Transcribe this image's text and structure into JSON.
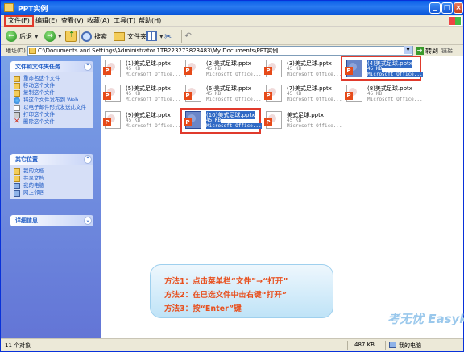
{
  "window": {
    "title": "PPT实例"
  },
  "menu": [
    "文件(F)",
    "编辑(E)",
    "查看(V)",
    "收藏(A)",
    "工具(T)",
    "帮助(H)"
  ],
  "toolbar": {
    "back_label": "后退",
    "search_label": "搜索",
    "folders_label": "文件夹"
  },
  "address": {
    "label": "地址(D)",
    "value": "C:\\Documents and Settings\\Administrator.1TB223273823483\\My Documents\\PPT实例",
    "go_label": "转到",
    "links_label": "链接"
  },
  "left": {
    "tasks_title": "文件和文件夹任务",
    "tasks": [
      "重命名这个文件",
      "移动这个文件",
      "复制这个文件",
      "将这个文件发布到 Web",
      "以电子邮件形式发送此文件",
      "打印这个文件",
      "删除这个文件"
    ],
    "places_title": "其它位置",
    "places": [
      "我的文档",
      "共享文档",
      "我的电脑",
      "网上邻居"
    ],
    "details_title": "详细信息"
  },
  "files": [
    {
      "name": "(1)美式足球.pptx",
      "size": "45 KB",
      "type": "Microsoft Office..."
    },
    {
      "name": "(2)美式足球.pptx",
      "size": "45 KB",
      "type": "Microsoft Office..."
    },
    {
      "name": "(3)美式足球.pptx",
      "size": "45 KB",
      "type": "Microsoft Office..."
    },
    {
      "name": "(4)美式足球.pptx",
      "size": "45 KB",
      "type": "Microsoft Office..."
    },
    {
      "name": "(5)美式足球.pptx",
      "size": "45 KB",
      "type": "Microsoft Office..."
    },
    {
      "name": "(6)美式足球.pptx",
      "size": "45 KB",
      "type": "Microsoft Office..."
    },
    {
      "name": "(7)美式足球.pptx",
      "size": "45 KB",
      "type": "Microsoft Office..."
    },
    {
      "name": "(8)美式足球.pptx",
      "size": "45 KB",
      "type": "Microsoft Office..."
    },
    {
      "name": "(9)美式足球.pptx",
      "size": "45 KB",
      "type": "Microsoft Office..."
    },
    {
      "name": "(10)美式足球.pptx",
      "size": "45 KB",
      "type": "Microsoft Office..."
    },
    {
      "name": "美式足球.pptx",
      "size": "45 KB",
      "type": "Microsoft Office..."
    }
  ],
  "callout": [
    "方法1：点击菜单栏“文件”→“打开”",
    "方法2：在已选文件中击右键“打开”",
    "方法3：按“Enter”键"
  ],
  "watermark": "考无忧 Easykao",
  "status": {
    "count": "11 个对象",
    "size": "487 KB",
    "location": "我的电脑"
  }
}
